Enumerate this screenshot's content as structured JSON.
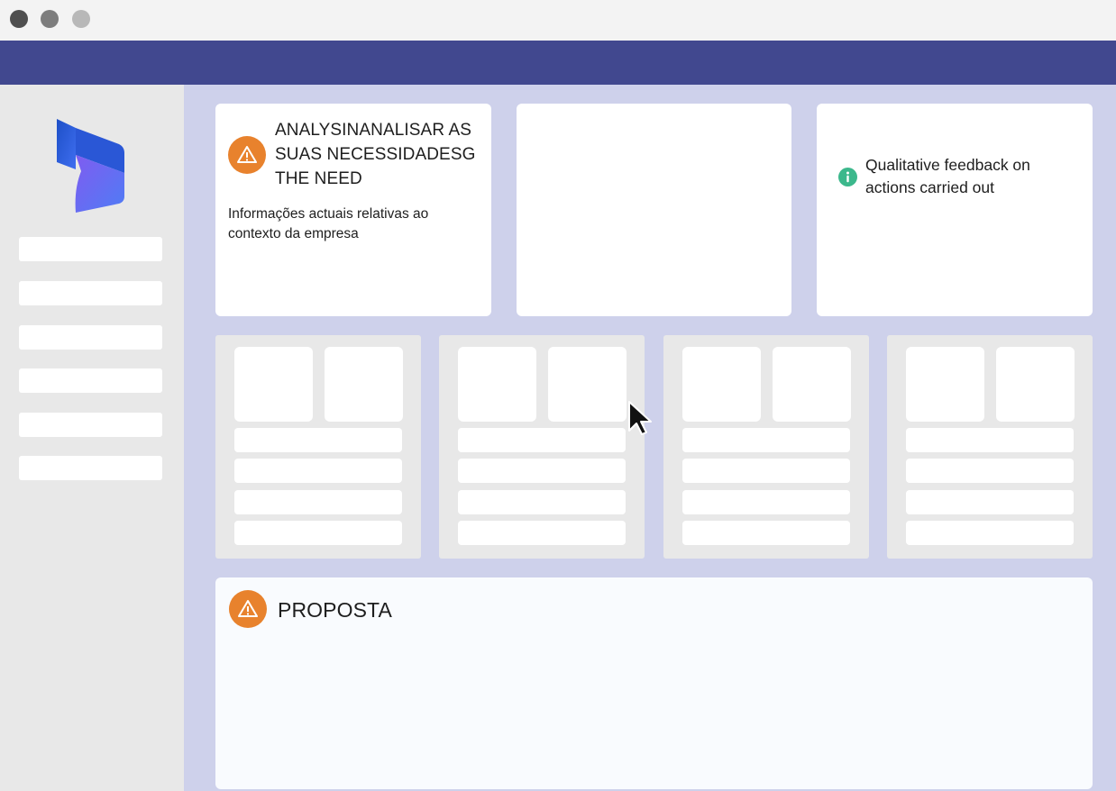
{
  "window": {
    "controls": [
      "close",
      "minimize",
      "maximize"
    ]
  },
  "colors": {
    "topbar": "#41488f",
    "main_background": "#ced1eb",
    "sidebar_background": "#e8e8e8",
    "warning": "#e8822d",
    "info": "#3cb88c"
  },
  "sidebar": {
    "logo_icon": "dynamics-logo-icon",
    "items": [
      "",
      "",
      "",
      "",
      "",
      ""
    ]
  },
  "cards": {
    "analysis": {
      "icon": "warning-icon",
      "title_line1": "ANALYSINANALISAR AS",
      "title_line2": "SUAS NECESSIDADESG",
      "title_line3": "THE NEED",
      "text_line1": "Informações actuais relativas ao",
      "text_line2": "contexto da empresa"
    },
    "blank": {},
    "feedback": {
      "icon": "info-icon",
      "text_line1": "Qualitative feedback on",
      "text_line2": "actions carried out"
    }
  },
  "panels": [
    {
      "tiles": 2,
      "rows": 4
    },
    {
      "tiles": 2,
      "rows": 4
    },
    {
      "tiles": 2,
      "rows": 4
    },
    {
      "tiles": 2,
      "rows": 4
    }
  ],
  "proposal": {
    "icon": "warning-icon",
    "title": "PROPOSTA"
  },
  "cursor": {
    "icon": "mouse-pointer-icon"
  }
}
